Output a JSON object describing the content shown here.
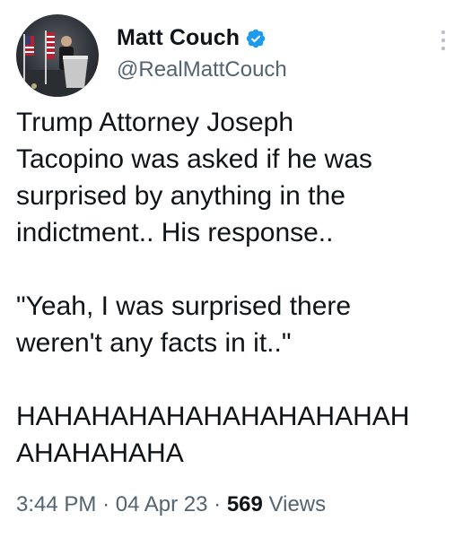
{
  "author": {
    "display_name": "Matt Couch",
    "handle": "@RealMattCouch",
    "avatar_icon": "profile-photo-podium",
    "verified_icon": "verified-badge-icon",
    "verified_color": "#1d9bf0"
  },
  "more_icon": "more-vertical-icon",
  "tweet": {
    "paragraphs": [
      "Trump Attorney Joseph\nTacopino was asked if he was\nsurprised by anything in the\nindictment.. His response..",
      "\"Yeah, I was surprised there\nweren't any facts in it..\"",
      "HAHAHAHAHAHAHAHAHAHAH\nAHAHAHAHA"
    ]
  },
  "meta": {
    "time": "3:44 PM",
    "separator": "·",
    "date": "04 Apr 23",
    "views_count": "569",
    "views_label": "Views"
  },
  "colors": {
    "text_primary": "#0f1419",
    "text_secondary": "#536471",
    "background": "#ffffff"
  }
}
